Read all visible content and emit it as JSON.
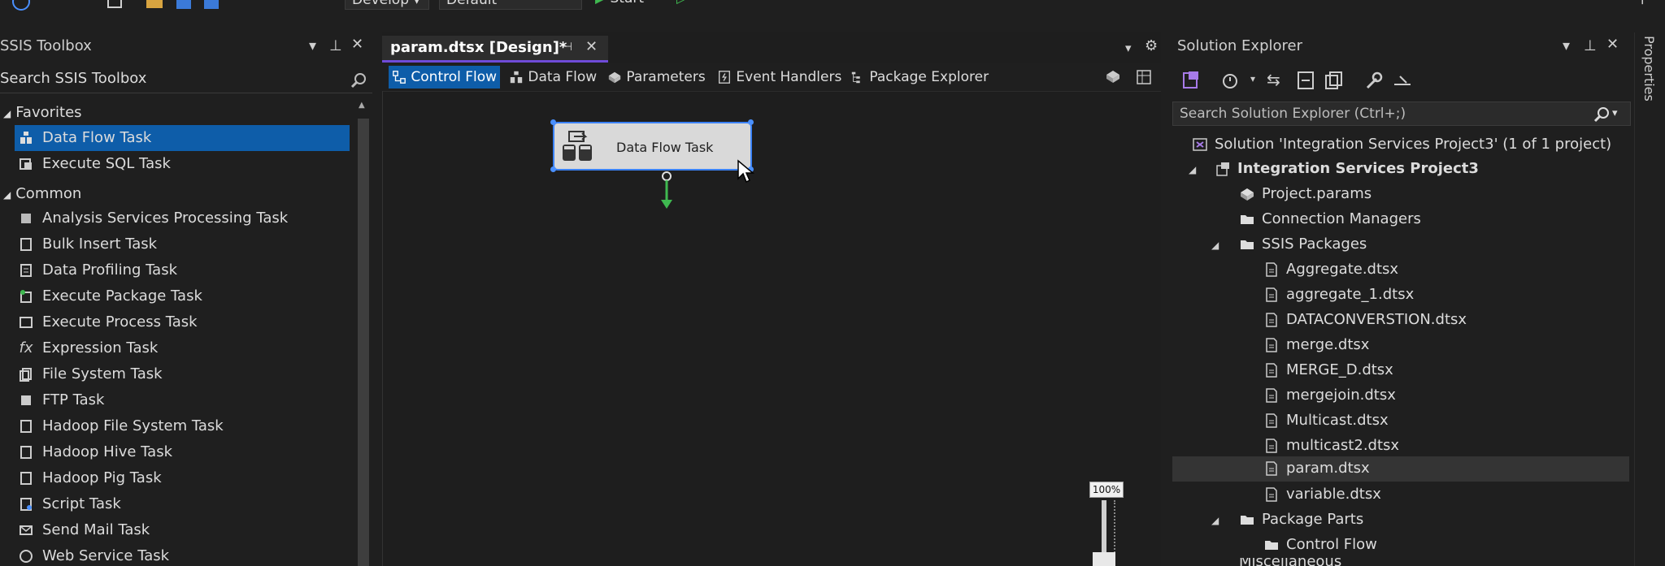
{
  "toolbar": {
    "config_combo": "Develop",
    "platform_combo": "Default",
    "start_label": "Start"
  },
  "toolbox": {
    "title": "SSIS Toolbox",
    "search_label": "Search SSIS Toolbox",
    "favorites_label": "Favorites",
    "favorites": [
      "Data Flow Task",
      "Execute SQL Task"
    ],
    "common_label": "Common",
    "common": [
      "Analysis Services Processing Task",
      "Bulk Insert Task",
      "Data Profiling Task",
      "Execute Package Task",
      "Execute Process Task",
      "Expression Task",
      "File System Task",
      "FTP Task",
      "Hadoop File System Task",
      "Hadoop Hive Task",
      "Hadoop Pig Task",
      "Script Task",
      "Send Mail Task",
      "Web Service Task"
    ]
  },
  "designer": {
    "tab_label": "param.dtsx [Design]*",
    "subtabs": [
      "Control Flow",
      "Data Flow",
      "Parameters",
      "Event Handlers",
      "Package Explorer"
    ],
    "task_label": "Data Flow Task",
    "zoom_label": "100%"
  },
  "solution_explorer": {
    "title": "Solution Explorer",
    "search_placeholder": "Search Solution Explorer (Ctrl+;)",
    "solution_label": "Solution 'Integration Services Project3' (1 of 1 project)",
    "project_label": "Integration Services Project3",
    "project_params": "Project.params",
    "connection_managers": "Connection Managers",
    "ssis_packages": "SSIS Packages",
    "packages": [
      "Aggregate.dtsx",
      "aggregate_1.dtsx",
      "DATACONVERSTION.dtsx",
      "merge.dtsx",
      "MERGE_D.dtsx",
      "mergejoin.dtsx",
      "Multicast.dtsx",
      "multicast2.dtsx",
      "param.dtsx",
      "variable.dtsx"
    ],
    "package_parts": "Package Parts",
    "control_flow": "Control Flow",
    "misc": "Miscellaneous"
  },
  "properties_tab": "Properties",
  "colors": {
    "accent": "#0e5da9",
    "tab_underline": "#6f4bd8",
    "start_green": "#3fb950"
  }
}
